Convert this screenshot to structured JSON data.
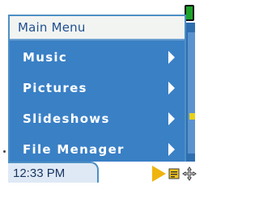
{
  "menu": {
    "title": "Main Menu",
    "items": [
      {
        "label": "Music"
      },
      {
        "label": "Pictures"
      },
      {
        "label": "Slideshows"
      },
      {
        "label": "File Menager"
      }
    ]
  },
  "status_bar": {
    "time": "12:33 PM"
  },
  "icons": {
    "submenu": "chevron-right-icon",
    "battery": "battery-icon",
    "play": "play-icon",
    "file": "file-icon",
    "move": "move-icon"
  },
  "colors": {
    "menu_bg": "#3a80c5",
    "header_bg": "#f2f4f2",
    "title_text": "#1f4f8f",
    "item_text": "#ffffff",
    "time_tab_bg": "#dfe9f6",
    "play_icon": "#f0b40f",
    "battery": "#1fa32a"
  }
}
